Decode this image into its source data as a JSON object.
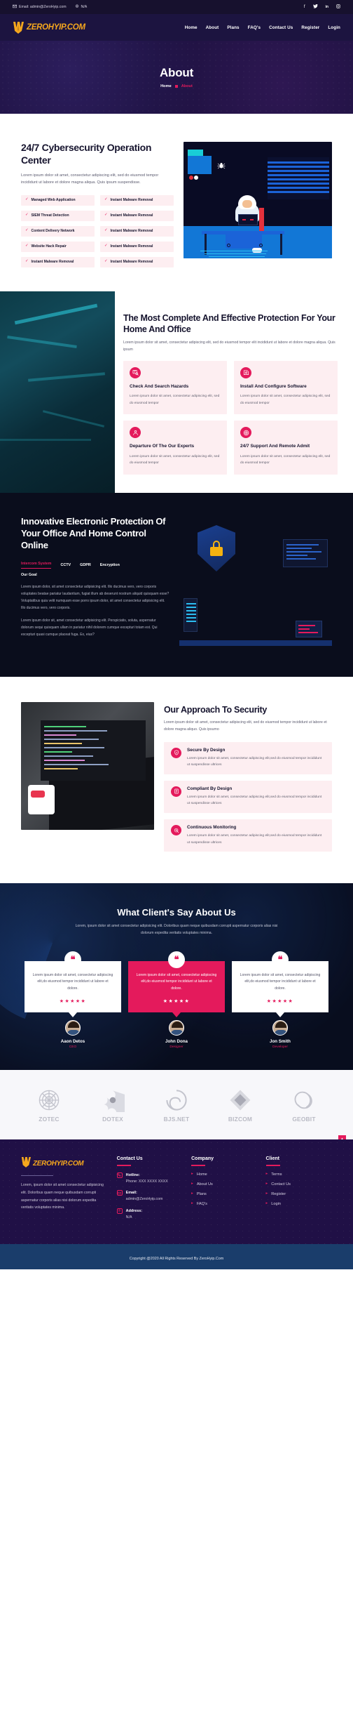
{
  "topbar": {
    "email_label": "Email: admin@ZeroHyip.com",
    "location_label": "N/A",
    "socials": [
      {
        "name": "facebook-icon",
        "glyph": "f"
      },
      {
        "name": "twitter-icon",
        "glyph": "ᴠ"
      },
      {
        "name": "linkedin-icon",
        "glyph": "in"
      },
      {
        "name": "instagram-icon",
        "glyph": "◎"
      }
    ]
  },
  "brand": {
    "name": "ZEROHYIP.COM",
    "accent": "#f5a71d"
  },
  "nav": {
    "items": [
      {
        "label": "Home"
      },
      {
        "label": "About"
      },
      {
        "label": "Plans"
      },
      {
        "label": "FAQ's"
      },
      {
        "label": "Contact Us"
      },
      {
        "label": "Register"
      },
      {
        "label": "Login"
      }
    ]
  },
  "banner": {
    "title": "About",
    "crumb_home": "Home",
    "crumb_current": "About"
  },
  "section_soc": {
    "title": "24/7 Cybersecurity Operation Center",
    "paragraph": "Lorem ipsum dolor sit amet, consectetur adipiscing elit, sed do eiusmod tempor incididunt ut labore et dolore magna aliqua. Quis ipsum suspendisse.",
    "features_left": [
      "Managed Web Application",
      "SIEM Threat Detection",
      "Content Delivery Network",
      "Website Hack Repair",
      "Instant Malware Removal"
    ],
    "features_right": [
      "Instant Malware Removal",
      "Instant Malware Removal",
      "Instant Malware Removal",
      "Instant Malware Removal",
      "Instant Malware Removal"
    ]
  },
  "section_protection": {
    "title": "The Most Complete And Effective Protection For Your Home And Office",
    "paragraph": "Lorem ipsum dolor sit amet, consectetur adipiscing elit, sed do eiusmod tempor elit incididunt ut labore et dolore magna aliqua. Quis ipsum",
    "cards": [
      {
        "icon": "search-hazard-icon",
        "title": "Check And Search Hazards",
        "text": "Lorem ipsum dolor sit amet, consectetur adipiscing elit, sed do eiusmod tempor"
      },
      {
        "icon": "install-software-icon",
        "title": "Install And Configure Software",
        "text": "Lorem ipsum dolor sit amet, consectetur adipiscing elit, sed do eiusmod tempor"
      },
      {
        "icon": "experts-icon",
        "title": "Departure Of The Our Experts",
        "text": "Lorem ipsum dolor sit amet, consectetur adipiscing elit, sed do eiusmod tempor"
      },
      {
        "icon": "remote-support-icon",
        "title": "24/7 Support And Remote Admit",
        "text": "Lorem ipsum dolor sit amet, consectetur adipiscing elit, sed do eiusmod tempor"
      }
    ]
  },
  "section_innovative": {
    "title": "Innovative Electronic Protection Of Your Office And Home Control Online",
    "tabs": [
      {
        "label": "Intercom System",
        "active": true
      },
      {
        "label": "CCTV",
        "active": false
      },
      {
        "label": "GDPR",
        "active": false
      },
      {
        "label": "Encryption",
        "active": false
      }
    ],
    "goal_label": "Our Goal",
    "paragraph1": "Lorem ipsum dolor, sit amet consectetur adipisicing elit. Illo ducimus vero, vero corporis voluptates beatae pariatur laudantium, fugiat illum ab deserunt nostrum aliquid quisquam esse? Voluptatibus quia velit numquam esse porro ipsum dolor, sit amet consectetur adipisicing elit. Illo ducimus vero, vero corporis.",
    "paragraph2": "Lorem ipsum dolor sit, amet consectetur adipisicing elit. Perspiciatis, soluta, aspernatur dolorum sequi quisquam ullam in pariatur nihil dolorem cumque excepturi totam est. Qui excepturi quasi cumque placeat fuga. Ex, eius?"
  },
  "section_approach": {
    "title": "Our Approach To Security",
    "paragraph": "Lorem ipsum dolor sit amet, consectetur adipiscing elit, sed do eiusmod tempor incididunt ut labore et dolore magna aliquo. Quis ipsumo",
    "rows": [
      {
        "icon": "secure-design-icon",
        "title": "Secure By Design",
        "text": "Lorem ipsum dolor sit amet, consectetur adipiscing elit,sed do eiusmod tempor incididunt ut suspendisse ultrices"
      },
      {
        "icon": "compliant-design-icon",
        "title": "Compliant By Design",
        "text": "Lorem ipsum dolor sit amet, consectetur adipiscing elit,sed do eiusmod tempor incididunt ut suspendisse ultrices"
      },
      {
        "icon": "continuous-monitoring-icon",
        "title": "Continuous Monitoring",
        "text": "Lorem ipsum dolor sit amet, consectetur adipiscing elit,sed do eiusmod tempor incididunt ut suspendisse ultrices"
      }
    ]
  },
  "section_testimonials": {
    "title": "What Client's Say About Us",
    "subtitle": "Lorem, ipsum dolor sit amet consectetur adipisicing elit. Doloribus quam neque quibusdam corrupti aspernatur corporis alias nisi dolorum expedita veritatis voluptates minima.",
    "items": [
      {
        "quote": "Lorem ipsum dolor sit amet, consectetur adipiscing elit,do eiusmod tempor incididunt ut labore et dolore.",
        "stars": "★★★★★",
        "name": "Aaon Detos",
        "role": "CEO",
        "highlight": false
      },
      {
        "quote": "Lorem ipsum dolor sit amet, consectetur adipiscing elit,do eiusmod tempor incididunt ut labore et dolore.",
        "stars": "★★★★★",
        "name": "John Dona",
        "role": "Designer",
        "highlight": true
      },
      {
        "quote": "Lorem ipsum dolor sit amet, consectetur adipiscing elit,do eiusmod tempor incididunt ut labore et dolore.",
        "stars": "★★★★★",
        "name": "Jon Smith",
        "role": "Developer",
        "highlight": false
      }
    ]
  },
  "brands": [
    {
      "name": "ZOTEC",
      "icon": "spiral-logo-icon"
    },
    {
      "name": "DOTEX",
      "icon": "fan-logo-icon"
    },
    {
      "name": "BJS.NET",
      "icon": "swirl-logo-icon"
    },
    {
      "name": "BIZCOM",
      "icon": "diamond-logo-icon"
    },
    {
      "name": "GEOBIT",
      "icon": "loop-logo-icon"
    }
  ],
  "footer": {
    "about_text": "Lorem, ipsum dolor sit amet consectetur adipisicing elit. Doloribus quam neque quibusdam corrupti aspernatur corporis alias nisi dolorum expedita veritatis voluptates minima.",
    "contact": {
      "heading": "Contact Us",
      "hotline_label": "Hotline:",
      "hotline_value": "Phone: XXX XXXX XXXX",
      "email_label": "Email:",
      "email_value": "admin@ZeroHyip.com",
      "address_label": "Address:",
      "address_value": "N/A"
    },
    "company": {
      "heading": "Company",
      "links": [
        "Home",
        "About Us",
        "Plans",
        "FAQ's"
      ]
    },
    "client": {
      "heading": "Client",
      "links": [
        "Terms",
        "Contact Us",
        "Register",
        "Login"
      ]
    },
    "copyright": "Copyright @2020 All Rights Reserved By ZeroHyip.Com",
    "back_to_top": "▲"
  }
}
